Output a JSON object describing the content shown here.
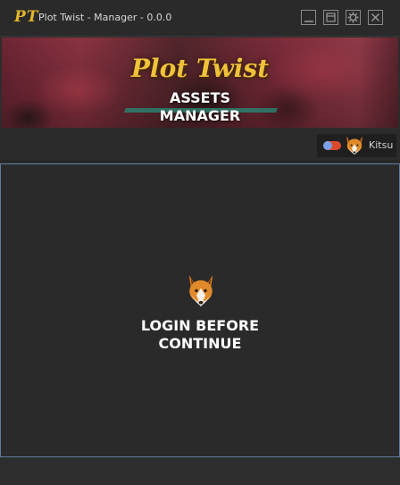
{
  "window": {
    "logo": "PT",
    "title": "Plot Twist - Manager - 0.0.0",
    "buttons": [
      "minimize-icon",
      "maximize-icon",
      "settings-icon",
      "close-icon"
    ]
  },
  "banner": {
    "logo_text": "Plot Twist",
    "subtitle_line1": "ASSETS",
    "subtitle_line2": "MANAGER"
  },
  "user": {
    "name": "Kitsu",
    "avatar": "fox-icon",
    "toggle_on": true
  },
  "main": {
    "message_line1": "LOGIN BEFORE",
    "message_line2": "CONTINUE",
    "icon": "fox-icon"
  },
  "colors": {
    "accent_gold": "#f0c23a",
    "panel_border": "#5f7e9c",
    "toggle_track": "#d94a2c",
    "toggle_knob": "#7aa0e8"
  }
}
